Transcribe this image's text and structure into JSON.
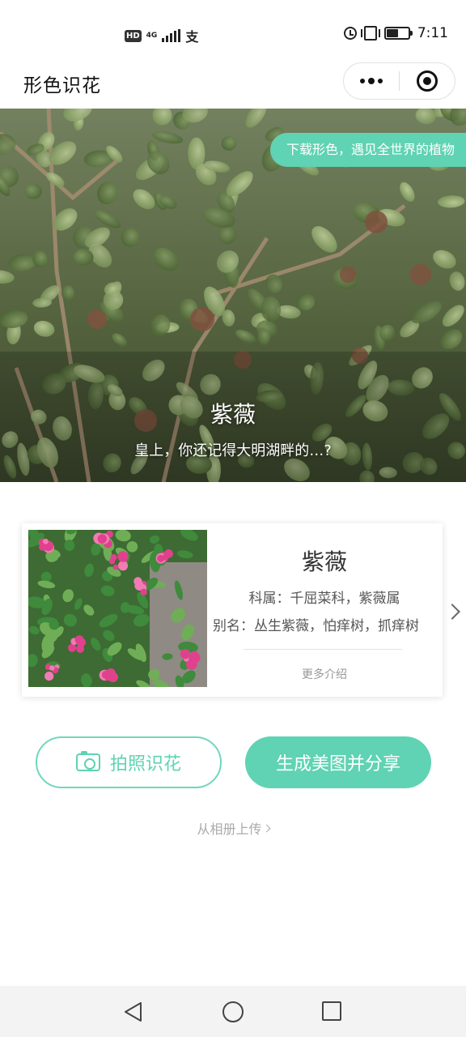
{
  "status_bar": {
    "network_badge": "HD",
    "network_type": "4G",
    "pay_glyph": "支",
    "time": "7:11",
    "battery_level": 0.55
  },
  "header": {
    "title": "形色识花",
    "more_icon": "more-dots-icon",
    "close_icon": "target-circle-icon"
  },
  "hero": {
    "download_banner": "下载形色，遇见全世界的植物",
    "plant_name": "紫薇",
    "quote": "皇上，你还记得大明湖畔的…?"
  },
  "card": {
    "name": "紫薇",
    "family": "科属：千屈菜科，紫薇属",
    "alias": "别名：丛生紫薇，怕痒树，抓痒树",
    "more": "更多介绍"
  },
  "actions": {
    "photo_button": "拍照识花",
    "share_button": "生成美图并分享",
    "album_link": "从相册上传"
  },
  "colors": {
    "accent": "#5fd3b3",
    "accent_border": "#6fd7bb",
    "muted_text": "#aaaaaa"
  }
}
